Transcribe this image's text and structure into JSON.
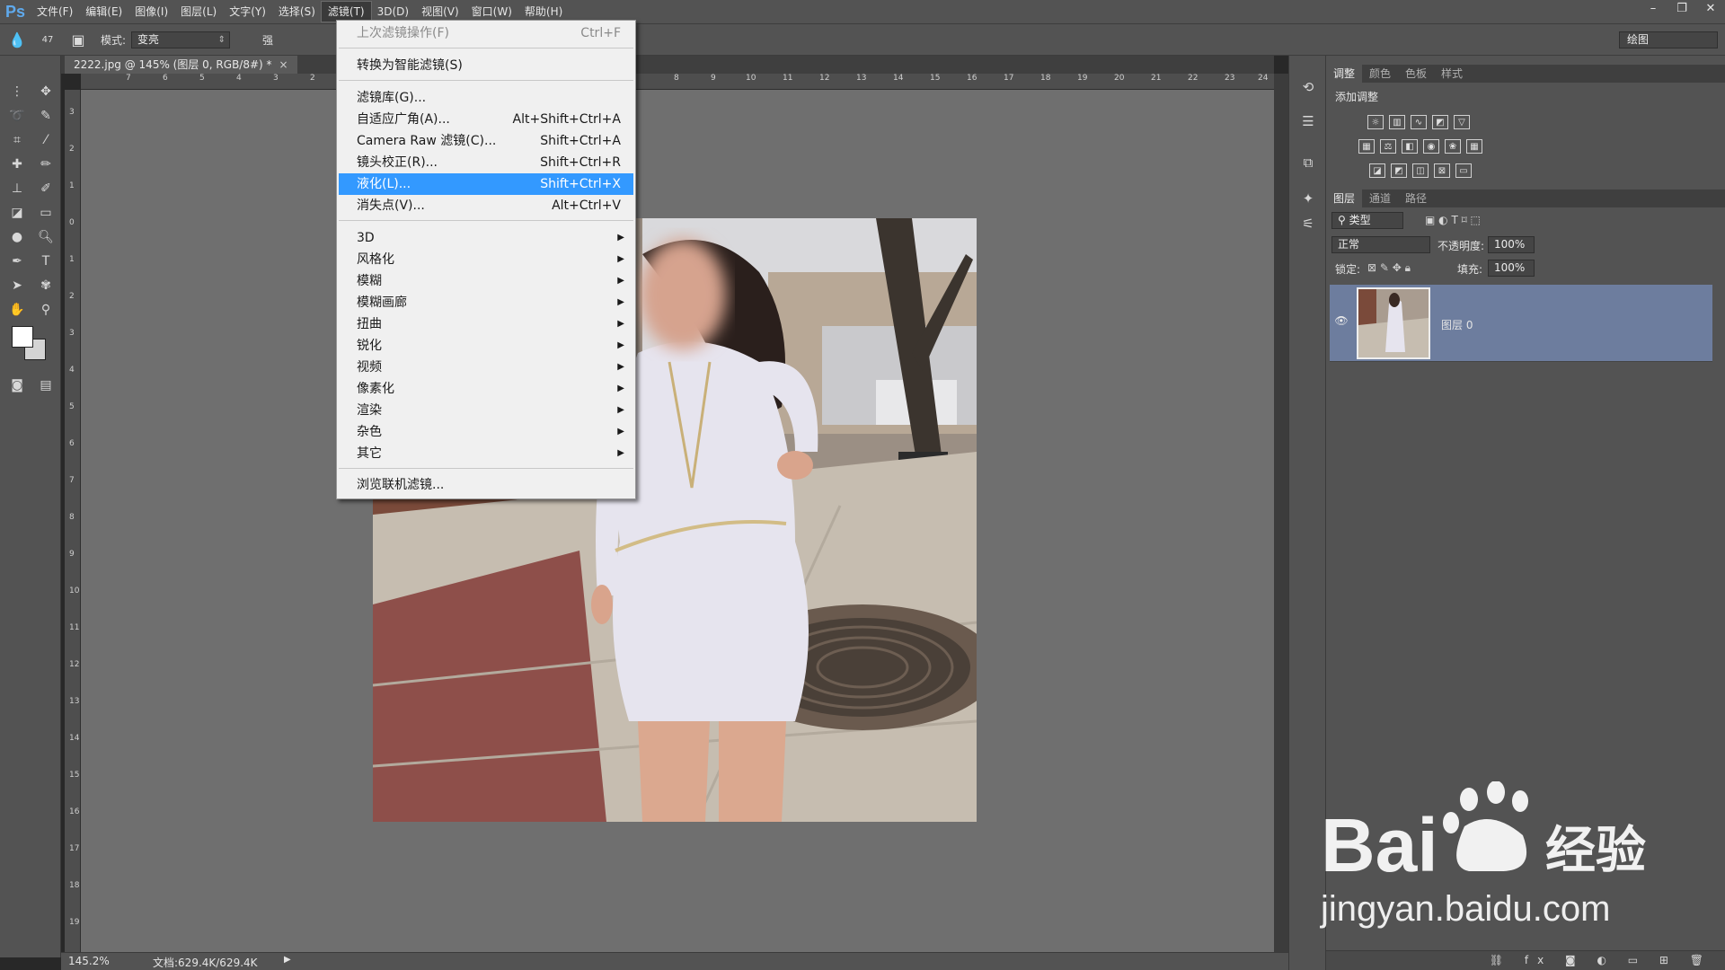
{
  "app": {
    "logo": "Ps"
  },
  "menubar": {
    "items": [
      "文件(F)",
      "编辑(E)",
      "图像(I)",
      "图层(L)",
      "文字(Y)",
      "选择(S)",
      "滤镜(T)",
      "3D(D)",
      "视图(V)",
      "窗口(W)",
      "帮助(H)"
    ],
    "active": "滤镜(T)"
  },
  "options": {
    "brush_size": "47",
    "mode_label": "模式:",
    "mode_value": "变亮",
    "strength_label_partial": "强",
    "workspace": "绘图"
  },
  "document": {
    "tab_title": "2222.jpg @ 145% (图层 0, RGB/8#) *",
    "close": "×",
    "hruler_labels": [
      "7",
      "6",
      "5",
      "4",
      "3",
      "2",
      "8",
      "9",
      "10",
      "11",
      "12",
      "13",
      "14",
      "15",
      "16",
      "17",
      "18",
      "19",
      "20",
      "21",
      "22",
      "23",
      "24"
    ],
    "vruler_labels": [
      "3",
      "2",
      "1",
      "0",
      "1",
      "2",
      "3",
      "4",
      "5",
      "6",
      "7",
      "8",
      "9",
      "10",
      "11",
      "12",
      "13",
      "14",
      "15",
      "16",
      "17",
      "18",
      "19"
    ]
  },
  "filter_menu": {
    "items": [
      {
        "label": "上次滤镜操作(F)",
        "shortcut": "Ctrl+F",
        "disabled": true
      },
      {
        "label": "转换为智能滤镜(S)",
        "shortcut": ""
      },
      {
        "label": "滤镜库(G)...",
        "shortcut": ""
      },
      {
        "label": "自适应广角(A)...",
        "shortcut": "Alt+Shift+Ctrl+A"
      },
      {
        "label": "Camera Raw 滤镜(C)...",
        "shortcut": "Shift+Ctrl+A"
      },
      {
        "label": "镜头校正(R)...",
        "shortcut": "Shift+Ctrl+R"
      },
      {
        "label": "液化(L)...",
        "shortcut": "Shift+Ctrl+X",
        "highlighted": true
      },
      {
        "label": "消失点(V)...",
        "shortcut": "Alt+Ctrl+V"
      },
      {
        "label": "3D",
        "submenu": true
      },
      {
        "label": "风格化",
        "submenu": true
      },
      {
        "label": "模糊",
        "submenu": true
      },
      {
        "label": "模糊画廊",
        "submenu": true
      },
      {
        "label": "扭曲",
        "submenu": true
      },
      {
        "label": "锐化",
        "submenu": true
      },
      {
        "label": "视频",
        "submenu": true
      },
      {
        "label": "像素化",
        "submenu": true
      },
      {
        "label": "渲染",
        "submenu": true
      },
      {
        "label": "杂色",
        "submenu": true
      },
      {
        "label": "其它",
        "submenu": true
      },
      {
        "label": "浏览联机滤镜...",
        "shortcut": ""
      }
    ]
  },
  "adjust_panel": {
    "tabs": [
      "调整",
      "颜色",
      "色板",
      "样式"
    ],
    "active_tab": "调整",
    "heading": "添加调整"
  },
  "layers_panel": {
    "tabs": [
      "图层",
      "通道",
      "路径"
    ],
    "active_tab": "图层",
    "filter_kind": "类型",
    "blend_mode": "正常",
    "opacity_label": "不透明度:",
    "opacity_value": "100%",
    "lock_label": "锁定:",
    "fill_label": "填充:",
    "fill_value": "100%",
    "layers": [
      {
        "name": "图层 0",
        "visible": true,
        "selected": true
      }
    ]
  },
  "status": {
    "zoom": "145.2%",
    "doc_info": "文档:629.4K/629.4K"
  },
  "watermark": {
    "brand": "Bai",
    "brand_cn": "经验",
    "url": "jingyan.baidu.com"
  },
  "colors": {
    "menu_highlight": "#3399ff",
    "layer_selected": "#6d7d9e"
  }
}
